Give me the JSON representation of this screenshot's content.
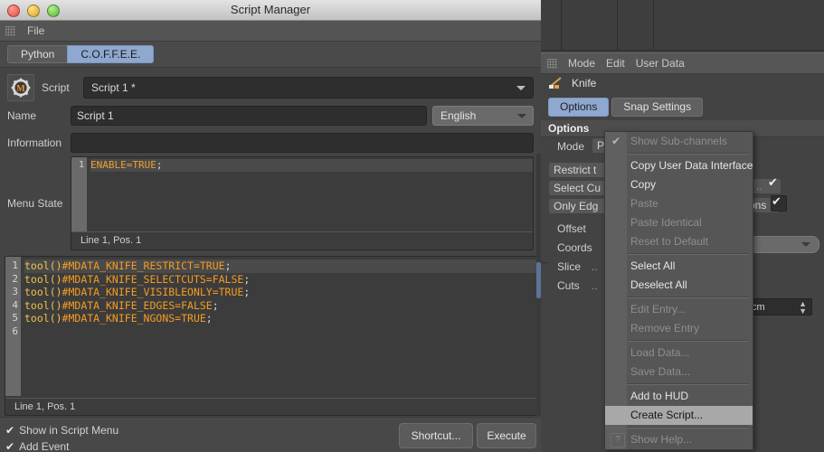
{
  "window": {
    "title": "Script Manager",
    "menu": [
      "File"
    ]
  },
  "language_tabs": [
    {
      "label": "Python",
      "active": false
    },
    {
      "label": "C.O.F.F.E.E.",
      "active": true
    }
  ],
  "script_selector": {
    "icon": "gear-m-icon",
    "label": "Script",
    "value": "Script 1 *"
  },
  "fields": {
    "name_label": "Name",
    "name_value": "Script 1",
    "language_value": "English",
    "information_label": "Information",
    "information_value": "",
    "menu_state_label": "Menu State"
  },
  "menu_state_editor": {
    "lines": [
      {
        "num": "1",
        "tokens": [
          {
            "t": "ENABLE=TRUE",
            "c": "kw"
          },
          {
            "t": ";",
            "c": "p"
          }
        ]
      }
    ],
    "status": "Line 1, Pos. 1"
  },
  "code_editor": {
    "lines": [
      {
        "num": "1",
        "tokens": [
          {
            "t": "tool()",
            "c": "fn"
          },
          {
            "t": "#MDATA_KNIFE_RESTRICT=TRUE",
            "c": "id"
          },
          {
            "t": ";",
            "c": "p"
          }
        ]
      },
      {
        "num": "2",
        "tokens": [
          {
            "t": "tool()",
            "c": "fn"
          },
          {
            "t": "#MDATA_KNIFE_SELECTCUTS=FALSE",
            "c": "id"
          },
          {
            "t": ";",
            "c": "p"
          }
        ]
      },
      {
        "num": "3",
        "tokens": [
          {
            "t": "tool()",
            "c": "fn"
          },
          {
            "t": "#MDATA_KNIFE_VISIBLEONLY=TRUE",
            "c": "id"
          },
          {
            "t": ";",
            "c": "p"
          }
        ]
      },
      {
        "num": "4",
        "tokens": [
          {
            "t": "tool()",
            "c": "fn"
          },
          {
            "t": "#MDATA_KNIFE_EDGES=FALSE",
            "c": "id"
          },
          {
            "t": ";",
            "c": "p"
          }
        ]
      },
      {
        "num": "5",
        "tokens": [
          {
            "t": "tool()",
            "c": "fn"
          },
          {
            "t": "#MDATA_KNIFE_NGONS=TRUE",
            "c": "id"
          },
          {
            "t": ";",
            "c": "p"
          }
        ]
      },
      {
        "num": "6",
        "tokens": []
      }
    ],
    "status": "Line 1, Pos. 1"
  },
  "bottom": {
    "checkboxes": [
      {
        "label": "Show in Script Menu",
        "checked": true,
        "mark": "✔"
      },
      {
        "label": "Add Event",
        "checked": true,
        "mark": "✔"
      }
    ],
    "shortcut_button": "Shortcut...",
    "execute_button": "Execute"
  },
  "attribute_manager": {
    "menu": [
      "Mode",
      "Edit",
      "User Data"
    ],
    "object_icon": "knife-tool-icon",
    "object_name": "Knife",
    "tabs": [
      {
        "label": "Options",
        "active": true
      },
      {
        "label": "Snap Settings",
        "active": false
      }
    ],
    "section_title": "Options",
    "rows": [
      {
        "label": "Mode",
        "value": "P"
      },
      {
        "label": "Restrict t"
      },
      {
        "label": "Select Cu"
      },
      {
        "label": "Only Edg"
      },
      {
        "label": "Offset"
      },
      {
        "label": "Coords"
      },
      {
        "label": "Slice",
        "suffix": ".."
      },
      {
        "label": "Cuts",
        "suffix": ".."
      }
    ],
    "right_fragments": {
      "dots": "..",
      "gons": "ons",
      "unit": "cm"
    }
  },
  "context_menu": {
    "items": [
      {
        "label": "Show Sub-channels",
        "state": "dim",
        "checked": true
      },
      {
        "sep": true
      },
      {
        "label": "Copy User Data Interface",
        "state": "normal"
      },
      {
        "label": "Copy",
        "state": "normal"
      },
      {
        "label": "Paste",
        "state": "dim"
      },
      {
        "label": "Paste Identical",
        "state": "dim"
      },
      {
        "label": "Reset to Default",
        "state": "dim"
      },
      {
        "sep": true
      },
      {
        "label": "Select All",
        "state": "normal"
      },
      {
        "label": "Deselect All",
        "state": "normal"
      },
      {
        "sep": true
      },
      {
        "label": "Edit Entry...",
        "state": "dim"
      },
      {
        "label": "Remove Entry",
        "state": "dim"
      },
      {
        "sep": true
      },
      {
        "label": "Load Data...",
        "state": "dim"
      },
      {
        "label": "Save Data...",
        "state": "dim"
      },
      {
        "sep": true
      },
      {
        "label": "Add to HUD",
        "state": "normal"
      },
      {
        "label": "Create Script...",
        "state": "selected"
      },
      {
        "sep": true
      },
      {
        "label": "Show Help...",
        "state": "dim",
        "help": true
      }
    ]
  },
  "colors": {
    "accent_blue": "#8fa8cf",
    "code_orange": "#f59b21",
    "code_yellow": "#f2c14a",
    "panel_bg": "#444444",
    "menu_bg": "#565656",
    "selection": "#a8a8a8"
  }
}
